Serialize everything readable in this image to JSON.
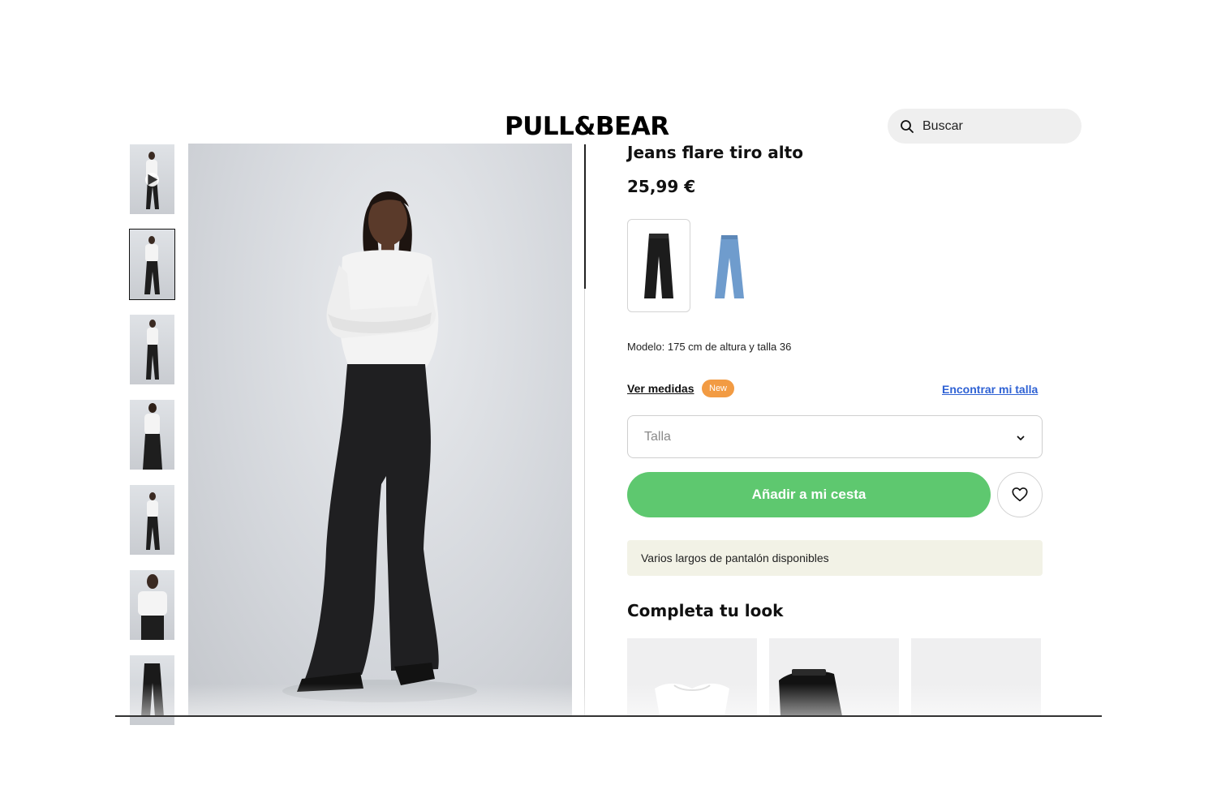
{
  "header": {
    "logo_text": "PULL&BEAR",
    "search": {
      "placeholder": "Buscar",
      "icon": "search-icon"
    }
  },
  "gallery": {
    "thumbnails": [
      {
        "label": "video",
        "icon": "play-icon"
      },
      {
        "label": "front",
        "selected": true
      },
      {
        "label": "side"
      },
      {
        "label": "back"
      },
      {
        "label": "full-side"
      },
      {
        "label": "detail-top"
      },
      {
        "label": "detail-jeans"
      }
    ]
  },
  "product": {
    "title": "Jeans flare tiro alto",
    "price": "25,99 €",
    "colors": [
      {
        "name": "black",
        "hex": "#1c1c1c",
        "selected": true
      },
      {
        "name": "blue",
        "hex": "#6f9ccd",
        "selected": false
      }
    ],
    "model_info": "Modelo: 175 cm de altura y talla 36",
    "size_guide_link": "Ver medidas",
    "new_badge": "New",
    "find_size_link": "Encontrar mi talla",
    "size_select": {
      "placeholder": "Talla",
      "icon": "chevron-down-icon"
    },
    "add_to_cart": "Añadir a mi cesta",
    "wishlist_icon": "heart-icon",
    "info_banner": "Varios largos de pantalón disponibles"
  },
  "complete_look": {
    "title": "Completa tu look",
    "items": [
      {
        "name": "white-top"
      },
      {
        "name": "black-boots"
      },
      {
        "name": "placeholder"
      }
    ]
  },
  "colors": {
    "cta_green": "#5ec86f",
    "badge_orange": "#f29b43",
    "link_blue": "#2f62d4",
    "banner_bg": "#f2f2e6",
    "search_bg": "#efefef"
  }
}
